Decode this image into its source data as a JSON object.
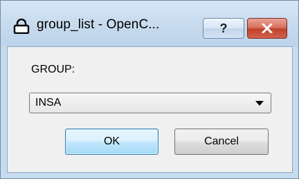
{
  "window": {
    "title": "group_list - OpenC...",
    "help_label": "?",
    "close_icon": "close-icon",
    "title_icon": "lock-icon"
  },
  "form": {
    "group_label": "GROUP:",
    "group_value": "INSA"
  },
  "buttons": {
    "ok_label": "OK",
    "cancel_label": "Cancel"
  },
  "colors": {
    "frame": "#c7dbef",
    "close_button": "#c2412b",
    "ok_border": "#3c7fb1"
  }
}
